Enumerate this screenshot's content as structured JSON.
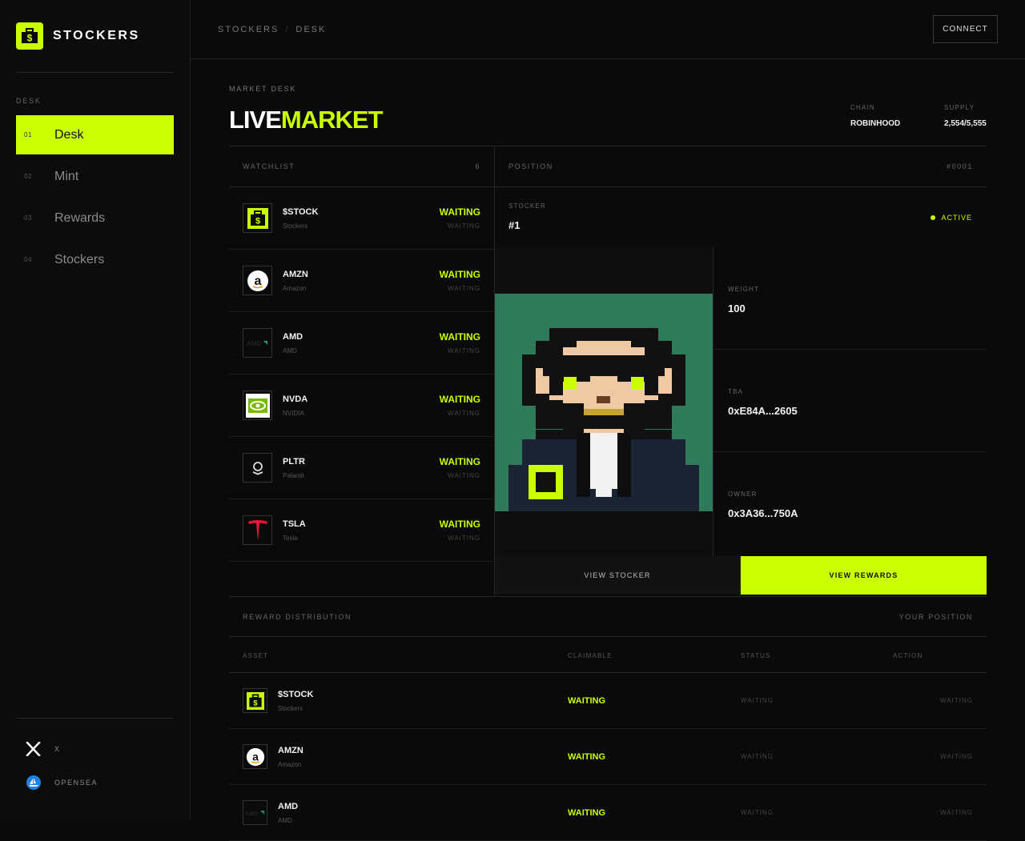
{
  "brand": {
    "name": "STOCKERS"
  },
  "sidebar": {
    "section": "DESK",
    "items": [
      {
        "num": "01",
        "label": "Desk",
        "active": true
      },
      {
        "num": "02",
        "label": "Mint"
      },
      {
        "num": "03",
        "label": "Rewards"
      },
      {
        "num": "04",
        "label": "Stockers"
      }
    ],
    "socials": [
      {
        "label": "X",
        "icon": "x-logo-icon"
      },
      {
        "label": "OPENSEA",
        "icon": "opensea-icon"
      }
    ]
  },
  "topbar": {
    "breadcrumb": [
      "STOCKERS",
      "/",
      "DESK"
    ],
    "connect_label": "CONNECT"
  },
  "header": {
    "eyebrow": "MARKET DESK",
    "title_a": "LIVE",
    "title_b": "MARKET",
    "chain_label": "CHAIN",
    "chain_value": "ROBINHOOD",
    "supply_label": "SUPPLY",
    "supply_value": "2,554/5,555"
  },
  "watchlist": {
    "title": "WATCHLIST",
    "count": "6",
    "rows": [
      {
        "symbol": "$STOCK",
        "name": "Stockers",
        "status": "WAITING",
        "sub": "WAITING",
        "icon": "stock-bag-icon"
      },
      {
        "symbol": "AMZN",
        "name": "Amazon",
        "status": "WAITING",
        "sub": "WAITING",
        "icon": "amazon-icon"
      },
      {
        "symbol": "AMD",
        "name": "AMD",
        "status": "WAITING",
        "sub": "WAITING",
        "icon": "amd-icon"
      },
      {
        "symbol": "NVDA",
        "name": "NVIDIA",
        "status": "WAITING",
        "sub": "WAITING",
        "icon": "nvidia-icon"
      },
      {
        "symbol": "PLTR",
        "name": "Palantir",
        "status": "WAITING",
        "sub": "WAITING",
        "icon": "palantir-icon"
      },
      {
        "symbol": "TSLA",
        "name": "Tesla",
        "status": "WAITING",
        "sub": "WAITING",
        "icon": "tesla-icon"
      }
    ]
  },
  "position": {
    "title": "POSITION",
    "id": "#0001",
    "stocker_label": "STOCKER",
    "stocker_value": "#1",
    "status": "ACTIVE",
    "props": [
      {
        "label": "WEIGHT",
        "value": "100"
      },
      {
        "label": "TBA",
        "value": "0xE84A...2605"
      },
      {
        "label": "OWNER",
        "value": "0x3A36...750A"
      }
    ],
    "view_stocker": "VIEW STOCKER",
    "view_rewards": "VIEW REWARDS"
  },
  "rewards": {
    "title": "REWARD DISTRIBUTION",
    "right": "YOUR POSITION",
    "columns": [
      "ASSET",
      "CLAIMABLE",
      "STATUS",
      "ACTION"
    ],
    "rows": [
      {
        "symbol": "$STOCK",
        "name": "Stockers",
        "claimable": "WAITING",
        "status": "WAITING",
        "action": "WAITING",
        "icon": "stock-bag-icon"
      },
      {
        "symbol": "AMZN",
        "name": "Amazon",
        "claimable": "WAITING",
        "status": "WAITING",
        "action": "WAITING",
        "icon": "amazon-icon"
      },
      {
        "symbol": "AMD",
        "name": "AMD",
        "claimable": "WAITING",
        "status": "WAITING",
        "action": "WAITING",
        "icon": "amd-icon"
      }
    ]
  },
  "colors": {
    "accent": "#c9ff00",
    "background": "#0a0a0a",
    "art_bg": "#2f7a5a"
  }
}
